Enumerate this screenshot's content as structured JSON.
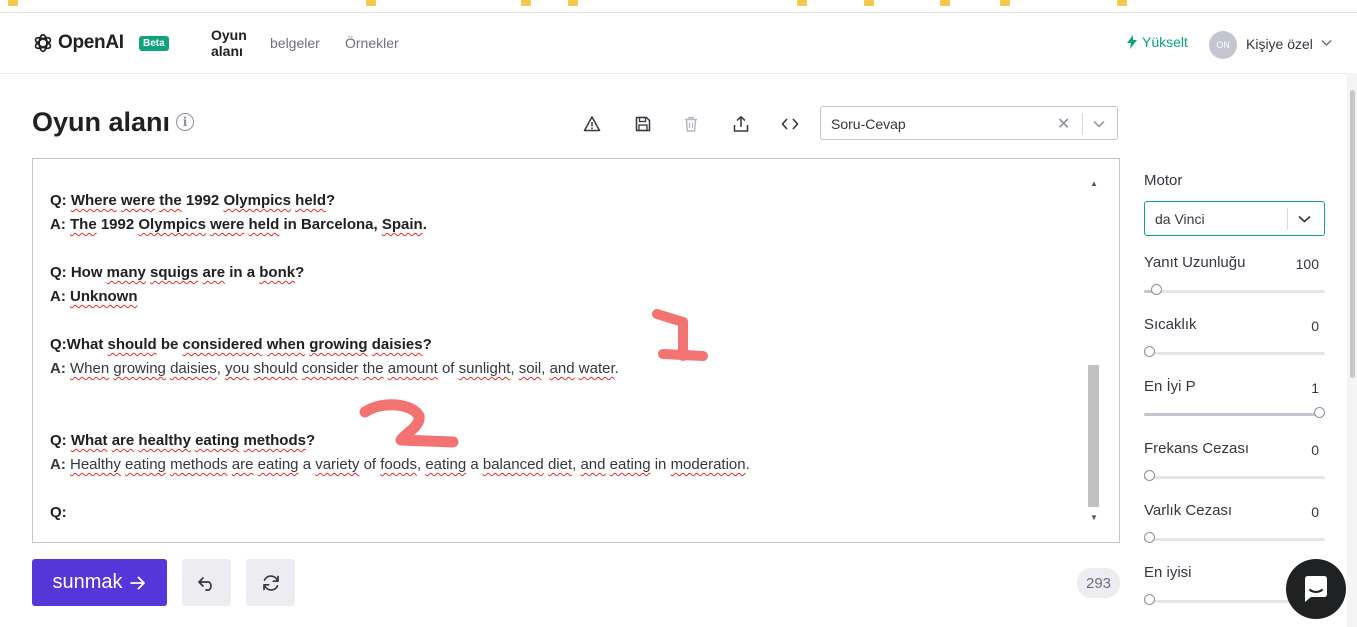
{
  "nav": {
    "logo_text": "OpenAI",
    "beta_badge": "Beta",
    "items": [
      {
        "label": "Oyun alanı",
        "active": true
      },
      {
        "label": "belgeler",
        "active": false
      },
      {
        "label": "Örnekler",
        "active": false
      }
    ],
    "upgrade_label": "Yükselt",
    "avatar_initials": "ON",
    "user_label": "Kişiye özel"
  },
  "page": {
    "title": "Oyun alanı"
  },
  "toolbar": {
    "icons": [
      "warning-icon",
      "save-icon",
      "trash-icon",
      "share-icon",
      "code-icon"
    ],
    "preset_value": "Soru-Cevap"
  },
  "editor": {
    "lines": [
      {
        "q": "Q: Where were the 1992 Olympics held?",
        "bold": true
      },
      {
        "q": "A: The 1992 Olympics were held in Barcelona, Spain.",
        "bold": true
      },
      {
        "q": "",
        "bold": false
      },
      {
        "q": "Q: How many squigs are in a bonk?",
        "bold": true
      },
      {
        "q": "A: Unknown",
        "bold": true
      },
      {
        "q": "",
        "bold": false
      },
      {
        "q": "Q:What should be considered when growing daisies?",
        "bold": true
      },
      {
        "q": "A: When growing daisies, you should consider the amount of sunlight, soil, and water.",
        "bold": false
      },
      {
        "q": "",
        "bold": false
      },
      {
        "q": "",
        "bold": false
      },
      {
        "q": "Q: What are healthy eating methods?",
        "bold": true
      },
      {
        "q": "A: Healthy eating methods are eating a variety of foods, eating a balanced diet, and eating in moderation.",
        "bold": false
      },
      {
        "q": "",
        "bold": false
      },
      {
        "q": "Q:",
        "bold": true
      }
    ],
    "annotation_1": "1",
    "annotation_2": "2"
  },
  "actions": {
    "submit_label": "sunmak",
    "token_count": "293"
  },
  "settings": {
    "engine_label": "Motor",
    "engine_value": "da Vinci",
    "params": [
      {
        "label": "Yanıt Uzunluğu",
        "value": "100",
        "fraction": 0.04
      },
      {
        "label": "Sıcaklık",
        "value": "0",
        "fraction": 0.0
      },
      {
        "label": "En İyi P",
        "value": "1",
        "fraction": 1.0
      },
      {
        "label": "Frekans Cezası",
        "value": "0",
        "fraction": 0.0
      },
      {
        "label": "Varlık Cezası",
        "value": "0",
        "fraction": 0.0
      },
      {
        "label": "En iyisi",
        "value": "",
        "fraction": 0.0
      }
    ]
  },
  "colors": {
    "accent": "#10a37f",
    "submit": "#5436da",
    "annotation": "#f05050"
  }
}
